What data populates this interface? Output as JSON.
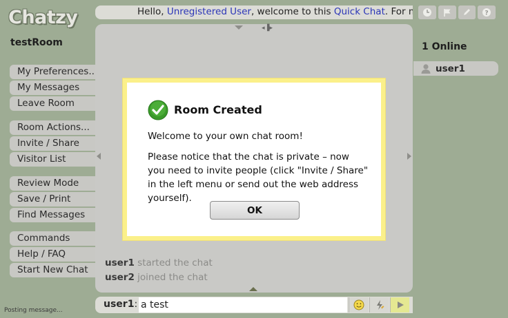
{
  "app": {
    "logo": "Chatzy"
  },
  "room": {
    "name": "testRoom"
  },
  "menu": {
    "group1": [
      "My Preferences...",
      "My Messages",
      "Leave Room"
    ],
    "group2": [
      "Room Actions...",
      "Invite / Share",
      "Visitor List"
    ],
    "group3": [
      "Review Mode",
      "Save / Print",
      "Find Messages"
    ],
    "group4": [
      "Commands",
      "Help / FAQ",
      "Start New Chat"
    ]
  },
  "status": {
    "posting": "Posting message..."
  },
  "topbar": {
    "greeting": "Hello, ",
    "user_link": "Unregistered User",
    "middle": ", welcome to this ",
    "chat_link": "Quick Chat",
    "suffix": ". For more"
  },
  "toolbar_icons": [
    "clock-icon",
    "flag-icon",
    "pencil-icon",
    "help-icon"
  ],
  "messages": [
    {
      "user": "user1",
      "text": "started the chat"
    },
    {
      "user": "user2",
      "text": "joined the chat"
    }
  ],
  "dialog": {
    "title": "Room Created",
    "line1": "Welcome to your own chat room!",
    "line2": "Please notice that the chat is private – now you need to invite people (click \"Invite / Share\" in the left menu or send out the web address yourself).",
    "ok_label": "OK"
  },
  "online": {
    "title": "1 Online",
    "users": [
      "user1"
    ]
  },
  "composer": {
    "user_label": "user1",
    "colon": ":",
    "value": "a test"
  },
  "colors": {
    "background": "#9eac94",
    "dialog_border": "#fbf08a",
    "link": "#2b35b8",
    "success_green": "#3a9a2a"
  }
}
